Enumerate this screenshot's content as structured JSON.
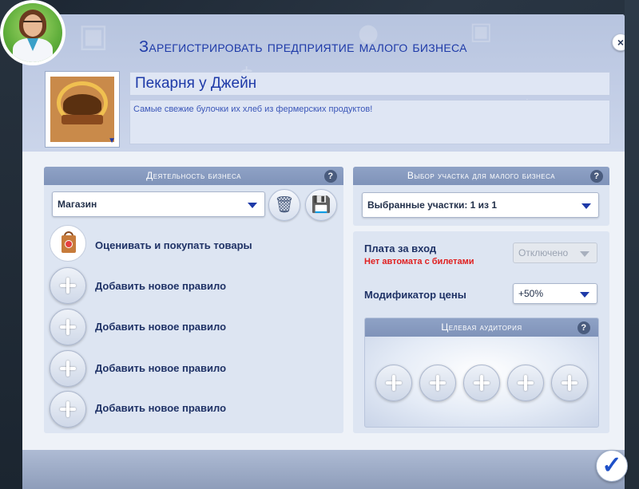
{
  "dialog": {
    "title": "Зарегистрировать предприятие малого бизнеса",
    "close_icon": "×",
    "confirm_icon": "✓"
  },
  "business": {
    "name": "Пекарня у Джейн",
    "description": "Самые свежие булочки их хлеб из фермерских продуктов!"
  },
  "activity": {
    "header": "Деятельность бизнеса",
    "help": "?",
    "type_selected": "Магазин",
    "delete_icon": "🗑",
    "save_icon": "💾",
    "rules": [
      {
        "label": "Оценивать и покупать товары",
        "icon": "shopping-bag-icon"
      },
      {
        "label": "Добавить новое правило",
        "icon": "plus-icon"
      },
      {
        "label": "Добавить новое правило",
        "icon": "plus-icon"
      },
      {
        "label": "Добавить новое правило",
        "icon": "plus-icon"
      },
      {
        "label": "Добавить новое правило",
        "icon": "plus-icon"
      }
    ]
  },
  "lot": {
    "header": "Выбор участка для малого бизнеса",
    "help": "?",
    "selected": "Выбранные участки: 1 из 1"
  },
  "settings": {
    "entry_fee_label": "Плата за вход",
    "entry_fee_warning": "Нет автомата с билетами",
    "entry_fee_value": "Отключено",
    "price_modifier_label": "Модификатор цены",
    "price_modifier_value": "+50%"
  },
  "audience": {
    "header": "Целевая аудитория",
    "help": "?",
    "slots": 5
  },
  "colors": {
    "accent": "#1e3aa8",
    "warning": "#e02020",
    "confirm": "#1e50c8"
  }
}
